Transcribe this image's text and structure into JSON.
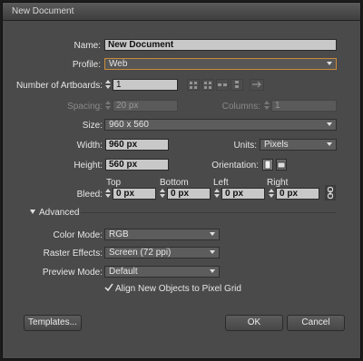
{
  "window": {
    "title": "New Document"
  },
  "name": {
    "label": "Name:",
    "value": "New Document"
  },
  "profile": {
    "label": "Profile:",
    "value": "Web"
  },
  "artboards": {
    "label": "Number of Artboards:",
    "value": "1"
  },
  "spacing": {
    "label": "Spacing:",
    "value": "20 px"
  },
  "columns": {
    "label": "Columns:",
    "value": "1"
  },
  "size": {
    "label": "Size:",
    "value": "960 x 560"
  },
  "width": {
    "label": "Width:",
    "value": "960 px"
  },
  "units": {
    "label": "Units:",
    "value": "Pixels"
  },
  "height": {
    "label": "Height:",
    "value": "560 px"
  },
  "orientation": {
    "label": "Orientation:"
  },
  "bleed": {
    "label": "Bleed:",
    "top_label": "Top",
    "top_value": "0 px",
    "bottom_label": "Bottom",
    "bottom_value": "0 px",
    "left_label": "Left",
    "left_value": "0 px",
    "right_label": "Right",
    "right_value": "0 px"
  },
  "advanced": {
    "label": "Advanced"
  },
  "color_mode": {
    "label": "Color Mode:",
    "value": "RGB"
  },
  "raster_effects": {
    "label": "Raster Effects:",
    "value": "Screen (72 ppi)"
  },
  "preview_mode": {
    "label": "Preview Mode:",
    "value": "Default"
  },
  "align_pixel_grid": {
    "label": "Align New Objects to Pixel Grid",
    "checked": true
  },
  "buttons": {
    "templates": "Templates...",
    "ok": "OK",
    "cancel": "Cancel"
  },
  "colors": {
    "dialog_bg": "#4a4a4a",
    "field_bg": "#c8c8c8",
    "highlight": "#c98a3a"
  }
}
